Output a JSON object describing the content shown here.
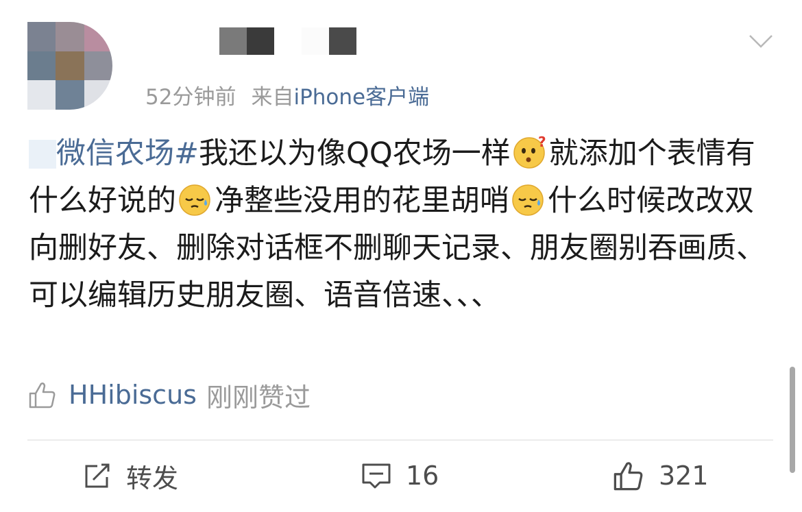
{
  "post": {
    "time": "52分钟前",
    "source_prefix": "来自",
    "source": "iPhone客户端",
    "topic": "微信农场#",
    "text_1": "我还以为像QQ农场一样",
    "text_2": "就添加个表情有什么好说的",
    "text_3": "净整些没用的花里胡哨",
    "text_4": "什么时候改改双向删好友、删除对话框不删聊天记录、朋友圈别吞画质、可以编辑历史朋友圈、语音倍速、、、",
    "emoji_icons": [
      "confused-face-emoji",
      "sweat-face-emoji",
      "sweat-face-emoji"
    ]
  },
  "likes": {
    "liker": "HHibiscus",
    "status": "刚刚赞过"
  },
  "actions": {
    "repost_label": "转发",
    "comment_count": "16",
    "like_count": "321"
  },
  "colors": {
    "link_blue": "#4a6b95",
    "meta_gray": "#9a9a9a",
    "text": "#1b1b1b"
  }
}
